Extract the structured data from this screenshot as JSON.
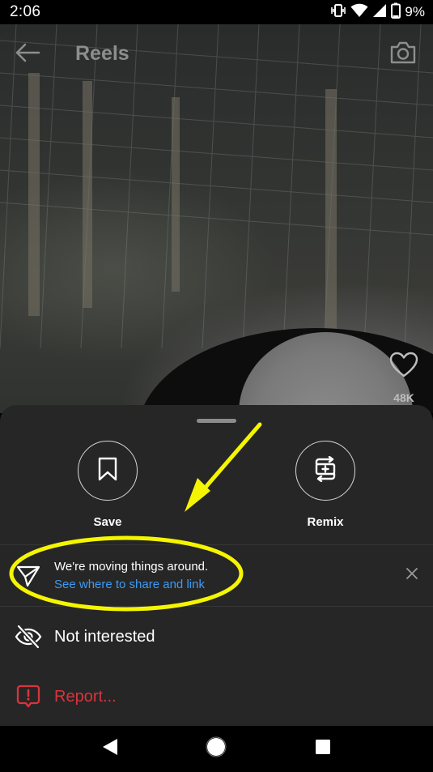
{
  "status_bar": {
    "time": "2:06",
    "battery": "9%"
  },
  "header": {
    "title": "Reels"
  },
  "reel": {
    "like_count": "48K"
  },
  "sheet": {
    "actions": [
      {
        "label": "Save",
        "icon": "bookmark-icon"
      },
      {
        "label": "Remix",
        "icon": "remix-icon"
      }
    ],
    "notice": {
      "title": "We're moving things around.",
      "link": "See where to share and link"
    },
    "menu": [
      {
        "label": "Not interested",
        "icon": "eye-off-icon",
        "color": "#ffffff"
      },
      {
        "label": "Report...",
        "icon": "report-icon",
        "color": "#d7353d"
      }
    ]
  },
  "colors": {
    "link": "#3d9bf2",
    "danger": "#d7353d",
    "annotation": "#f5f500",
    "sheet_background": "#262626"
  }
}
